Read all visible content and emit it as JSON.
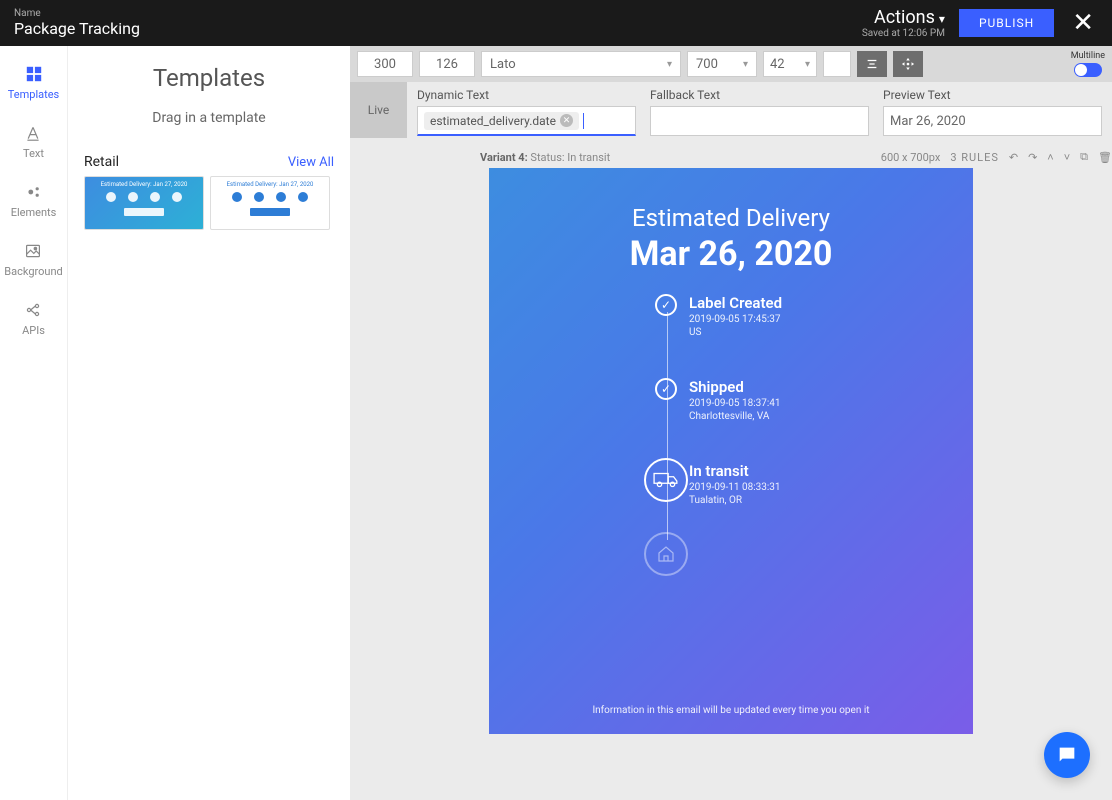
{
  "header": {
    "name_label": "Name",
    "name": "Package Tracking",
    "actions": "Actions",
    "saved_at": "Saved at 12:06 PM",
    "publish": "PUBLISH"
  },
  "rail": {
    "templates": "Templates",
    "text": "Text",
    "elements": "Elements",
    "background": "Background",
    "apis": "APIs"
  },
  "panel": {
    "title": "Templates",
    "subtitle": "Drag in a template",
    "category": "Retail",
    "view_all": "View All",
    "thumb1_title": "Estimated Delivery: Jan 27, 2020",
    "thumb2_title": "Estimated Delivery: Jan 27, 2020"
  },
  "toolbar": {
    "x": "300",
    "y": "126",
    "font": "Lato",
    "weight": "700",
    "size": "42",
    "multiline_label": "Multiline"
  },
  "dyn": {
    "live": "Live",
    "dynamic_label": "Dynamic Text",
    "tag": "estimated_delivery.date",
    "fallback_label": "Fallback Text",
    "fallback_value": "",
    "preview_label": "Preview Text",
    "preview_value": "Mar 26, 2020"
  },
  "meta": {
    "variant": "Variant 4:",
    "status": "Status: In transit",
    "dims": "600 x 700px",
    "rules": "3 RULES"
  },
  "preview": {
    "heading": "Estimated Delivery",
    "date": "Mar 26, 2020",
    "footer": "Information in this email will be updated every time you open it",
    "items": [
      {
        "title": "Label Created",
        "time": "2019-09-05 17:45:37",
        "loc": "US"
      },
      {
        "title": "Shipped",
        "time": "2019-09-05 18:37:41",
        "loc": "Charlottesville, VA"
      },
      {
        "title": "In transit",
        "time": "2019-09-11 08:33:31",
        "loc": "Tualatin, OR"
      }
    ]
  }
}
